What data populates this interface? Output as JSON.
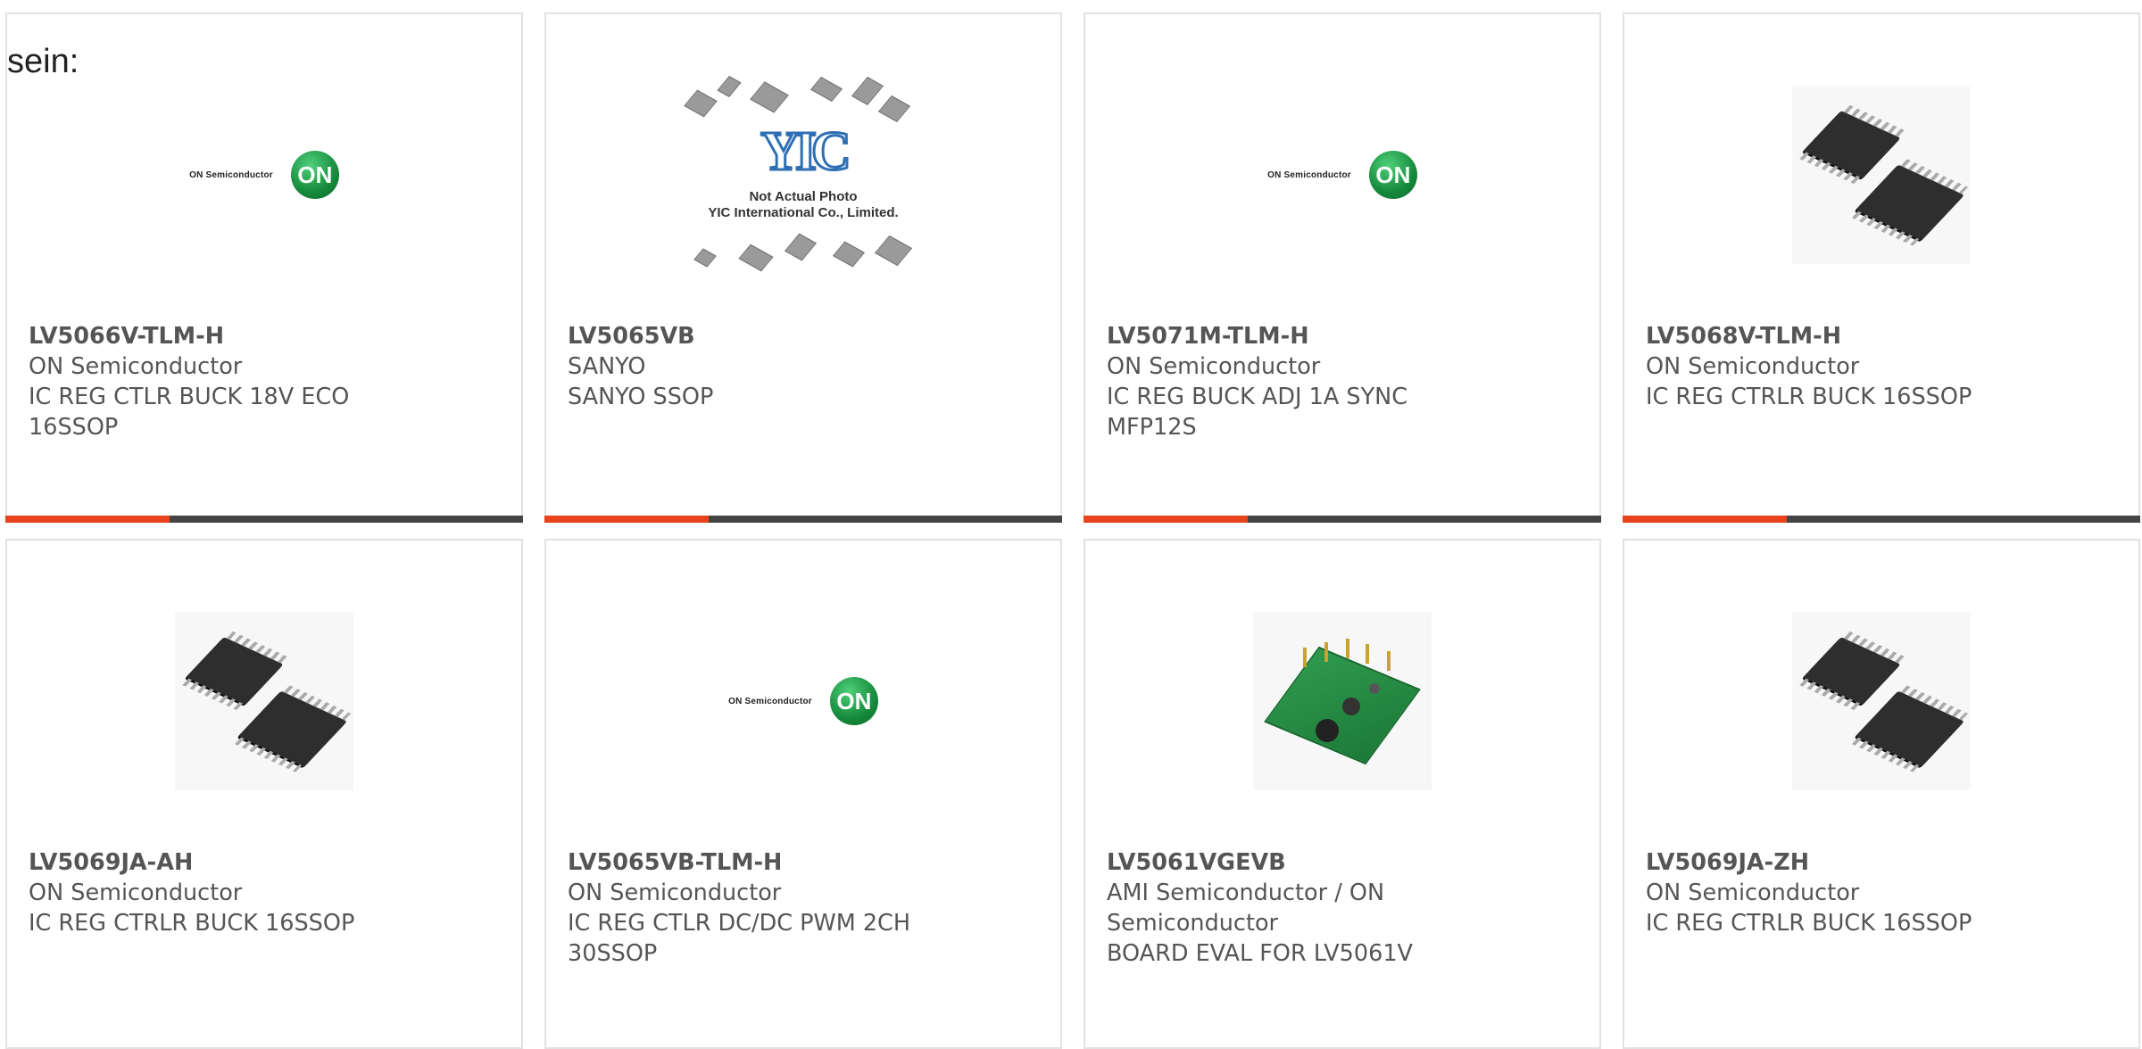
{
  "lead_text": "sein:",
  "accent_color": "#e8431a",
  "bar_color": "#444444",
  "logo_text": "ON Semiconductor",
  "logo_mark": "ON",
  "yic": {
    "mark": "YIC",
    "note_line1": "Not Actual Photo",
    "note_line2": "YIC International Co., Limited."
  },
  "products": [
    {
      "part": "LV5066V-TLM-H",
      "manufacturer": "ON Semiconductor",
      "description": "IC REG CTLR BUCK 18V ECO 16SSOP",
      "image": "on-semiconductor-logo"
    },
    {
      "part": "LV5065VB",
      "manufacturer": "SANYO",
      "description": "SANYO SSOP",
      "image": "yic-not-actual-photo"
    },
    {
      "part": "LV5071M-TLM-H",
      "manufacturer": "ON Semiconductor",
      "description": "IC REG BUCK ADJ 1A SYNC MFP12S",
      "image": "on-semiconductor-logo"
    },
    {
      "part": "LV5068V-TLM-H",
      "manufacturer": "ON Semiconductor",
      "description": "IC REG CTRLR BUCK 16SSOP",
      "image": "ssop-chip-photo"
    },
    {
      "part": "LV5069JA-AH",
      "manufacturer": "ON Semiconductor",
      "description": "IC REG CTRLR BUCK 16SSOP",
      "image": "ssop-chip-photo"
    },
    {
      "part": "LV5065VB-TLM-H",
      "manufacturer": "ON Semiconductor",
      "description": "IC REG CTLR DC/DC PWM 2CH 30SSOP",
      "image": "on-semiconductor-logo"
    },
    {
      "part": "LV5061VGEVB",
      "manufacturer": "AMI Semiconductor / ON Semiconductor",
      "description": "BOARD EVAL FOR LV5061V",
      "image": "eval-board-photo"
    },
    {
      "part": "LV5069JA-ZH",
      "manufacturer": "ON Semiconductor",
      "description": "IC REG CTRLR BUCK 16SSOP",
      "image": "ssop-chip-photo"
    }
  ]
}
